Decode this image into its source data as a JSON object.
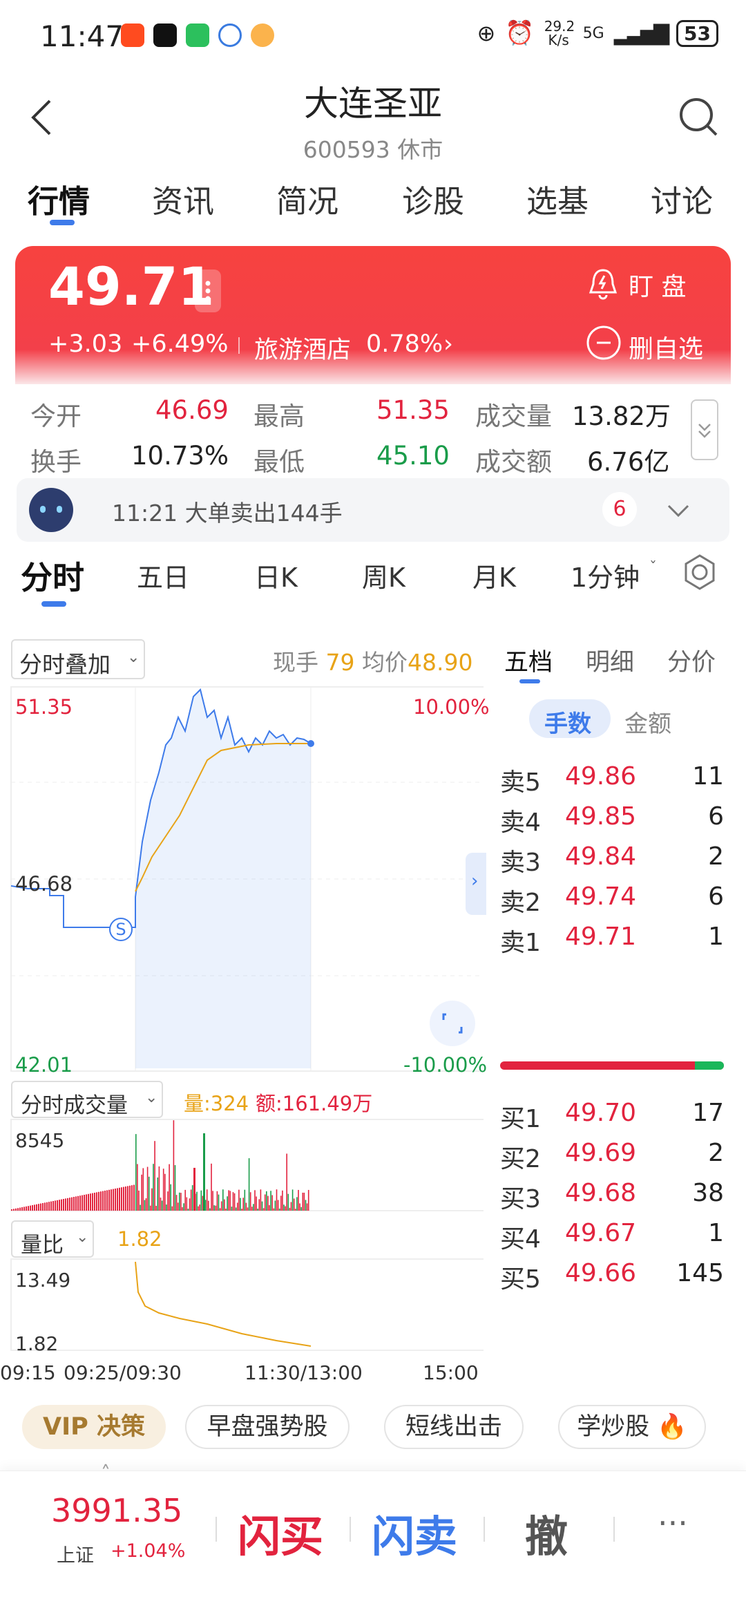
{
  "status": {
    "time": "11:47",
    "net": "29.2\nK/s",
    "signal": "5G",
    "battery": "53"
  },
  "header": {
    "title": "大连圣亚",
    "subtitle": "600593 休市"
  },
  "tabs": [
    "行情",
    "资讯",
    "简况",
    "诊股",
    "选基",
    "讨论"
  ],
  "banner": {
    "price": "49.71",
    "change": "+3.03",
    "pct": "+6.49%",
    "sector": "旅游酒店",
    "sector_pct": "0.78%",
    "watch": "盯 盘",
    "remove": "删自选"
  },
  "stats": {
    "open_label": "今开",
    "open": "46.69",
    "high_label": "最高",
    "high": "51.35",
    "vol_label": "成交量",
    "vol": "13.82万",
    "turn_label": "换手",
    "turn": "10.73%",
    "low_label": "最低",
    "low": "45.10",
    "amt_label": "成交额",
    "amt": "6.76亿"
  },
  "notice": {
    "text": "11:21 大单卖出144手",
    "count": "6"
  },
  "chart_tabs": [
    "分时",
    "五日",
    "日K",
    "周K",
    "月K",
    "1分钟"
  ],
  "chart": {
    "overlay": "分时叠加",
    "now_label": "现手",
    "now": "79",
    "avg_label": "均价",
    "avg": "48.90",
    "top_price": "51.35",
    "top_pct": "10.00%",
    "mid_price": "46.68",
    "bot_price": "42.01",
    "bot_pct": "-10.00%",
    "vol_menu": "分时成交量",
    "vol_label": "量:324",
    "amt_label": "额:161.49万",
    "vol_max": "8545",
    "ratio_menu": "量比",
    "ratio_val": "1.82",
    "ratio_max": "13.49",
    "ratio_min": "1.82",
    "time_labels": [
      "09:15",
      "09:25/09:30",
      "11:30/13:00",
      "15:00"
    ]
  },
  "book_tabs": [
    "五档",
    "明细",
    "分价"
  ],
  "book_toggle": [
    "手数",
    "金额"
  ],
  "asks": [
    {
      "label": "卖5",
      "price": "49.86",
      "qty": "11"
    },
    {
      "label": "卖4",
      "price": "49.85",
      "qty": "6"
    },
    {
      "label": "卖3",
      "price": "49.84",
      "qty": "2"
    },
    {
      "label": "卖2",
      "price": "49.74",
      "qty": "6"
    },
    {
      "label": "卖1",
      "price": "49.71",
      "qty": "1"
    }
  ],
  "bids": [
    {
      "label": "买1",
      "price": "49.70",
      "qty": "17"
    },
    {
      "label": "买2",
      "price": "49.69",
      "qty": "2"
    },
    {
      "label": "买3",
      "price": "49.68",
      "qty": "38"
    },
    {
      "label": "买4",
      "price": "49.67",
      "qty": "1"
    },
    {
      "label": "买5",
      "price": "49.66",
      "qty": "145"
    }
  ],
  "pills": [
    "VIP 决策",
    "早盘强势股",
    "短线出击",
    "学炒股"
  ],
  "bottom": {
    "index": "3991.35",
    "index_name": "上证",
    "index_pct": "+1.04%",
    "buy": "闪买",
    "sell": "闪卖",
    "cancel": "撤",
    "more": "···"
  },
  "colors": {
    "up": "#e2233e",
    "down": "#1a9c4a",
    "accent": "#3e7bea",
    "avg_line": "#e8a317"
  }
}
